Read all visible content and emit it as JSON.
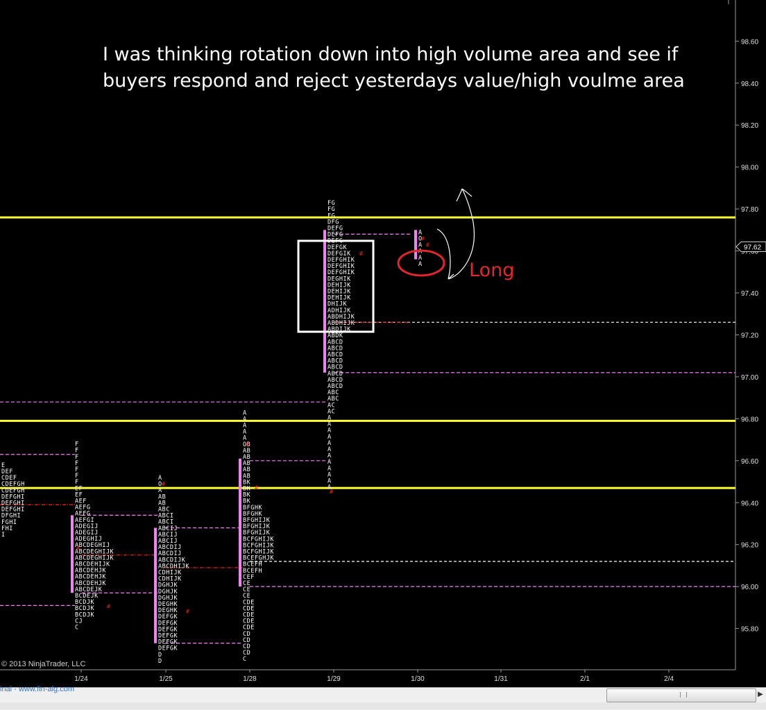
{
  "annotation": {
    "line1": "I was thinking rotation down into high volume area and see if",
    "line2": "buyers respond and reject yesterdays value/high voulme area",
    "long_label": "Long"
  },
  "copyright": "2013 NinjaTrader, LLC",
  "footer_link": "inal - www.fin-alg.com",
  "price_marker": "97.62",
  "colors": {
    "yellow": "#ffff33",
    "pink": "#ee82ee",
    "red": "#ff2020",
    "white": "#ffffff",
    "grid": "#555555"
  },
  "chart_data": {
    "type": "table",
    "description_free": true,
    "y_axis": {
      "ticks": [
        95.8,
        96.0,
        96.2,
        96.4,
        96.6,
        96.8,
        97.0,
        97.2,
        97.4,
        97.6,
        97.8,
        98.0,
        98.2,
        98.4,
        98.6
      ],
      "labels": [
        "95.80",
        "96.00",
        "96.20",
        "96.40",
        "96.60",
        "96.80",
        "97.00",
        "97.20",
        "97.40",
        "97.60",
        "97.80",
        "98.00",
        "98.20",
        "98.40",
        "98.60"
      ],
      "range": [
        95.64,
        98.72
      ]
    },
    "x_axis": {
      "categories": [
        "1/24",
        "1/25",
        "1/28",
        "1/29",
        "1/30",
        "1/31",
        "2/1",
        "2/4"
      ]
    },
    "horizontal_levels": [
      {
        "price": 97.76,
        "color": "yellow"
      },
      {
        "price": 96.79,
        "color": "yellow"
      },
      {
        "price": 96.47,
        "color": "yellow"
      }
    ],
    "reference_lines": [
      {
        "price": 97.68,
        "from": "1/29",
        "to": "1/30",
        "style": "pink-dash"
      },
      {
        "price": 97.26,
        "from": "1/29",
        "to": "end",
        "style": "white-dash"
      },
      {
        "price": 97.26,
        "from": "1/29",
        "to": "1/30",
        "style": "red-dashdot"
      },
      {
        "price": 97.02,
        "from": "1/29",
        "to": "end",
        "style": "pink-dash"
      },
      {
        "price": 96.88,
        "from": "start",
        "to": "1/29",
        "style": "pink-dash"
      },
      {
        "price": 96.63,
        "from": "start",
        "to": "1/24",
        "style": "pink-dash"
      },
      {
        "price": 96.6,
        "from": "1/28",
        "to": "1/29",
        "style": "pink-dash"
      },
      {
        "price": 96.12,
        "from": "1/28",
        "to": "end",
        "style": "white-dash"
      },
      {
        "price": 96.0,
        "from": "1/28",
        "to": "end",
        "style": "pink-dash"
      },
      {
        "price": 95.91,
        "from": "start",
        "to": "1/24",
        "style": "pink-dash"
      },
      {
        "price": 96.39,
        "from": "start",
        "to": "1/24",
        "style": "red-dashdot"
      },
      {
        "price": 96.34,
        "from": "1/24",
        "to": "1/25",
        "style": "pink-dash"
      },
      {
        "price": 96.15,
        "from": "1/24",
        "to": "1/25",
        "style": "red-dashdot"
      },
      {
        "price": 95.97,
        "from": "1/24",
        "to": "1/25",
        "style": "pink-dash"
      },
      {
        "price": 96.28,
        "from": "1/25",
        "to": "1/28",
        "style": "pink-dash"
      },
      {
        "price": 96.09,
        "from": "1/25",
        "to": "1/28",
        "style": "red-dashdot"
      },
      {
        "price": 95.73,
        "from": "1/25",
        "to": "1/28",
        "style": "pink-dash"
      }
    ],
    "profiles": [
      {
        "session": "1/23",
        "letters": [
          "E",
          "DEF",
          "CDEF",
          "CDEFGH",
          "CDEFGH",
          "DEFGHI",
          "DEFGHI",
          "DEFGHI",
          "DFGHI",
          "FGHI",
          "FHI",
          "I"
        ],
        "top": 96.57
      },
      {
        "session": "1/24",
        "letters": [
          "F",
          "F",
          "F",
          "F",
          "F",
          "F",
          "F",
          "EF",
          "EF",
          "AEF",
          "AEFG",
          "AEFG",
          "AEFGI",
          "ADEGIJ",
          "ADEGIJ",
          "ADEGHIJ",
          "ABCDEGHIJ",
          "ABCDEGHIJK",
          "ABCDEGHIJK",
          "ABCDEHIJK",
          "ABCDEHJK",
          "ABCDEHJK",
          "ABCDEHJK",
          "ABCDEJK",
          "BCDEJK",
          "BCDJK",
          "BCDJK",
          "BCDJK",
          "CJ",
          "C"
        ],
        "top": 96.67
      },
      {
        "session": "1/25",
        "letters": [
          "A",
          "O",
          "A",
          "AB",
          "AB",
          "ABC",
          "ABCI",
          "ABCI",
          "ABCIJ",
          "ABCIJ",
          "ABCIJ",
          "ABCDIJ",
          "ABCDIJ",
          "ABCDIJK",
          "ABCDHIJK",
          "CDHIJK",
          "CDHIJK",
          "DGHJK",
          "DGHJK",
          "DGHJK",
          "DEGHK",
          "DEGHK",
          "DEFGK",
          "DEFGK",
          "DEFGK",
          "DEFGK",
          "DEFGK",
          "DEFGK",
          "D",
          "D"
        ],
        "top": 96.51
      },
      {
        "session": "1/28",
        "letters": [
          "A",
          "A",
          "A",
          "A",
          "A",
          "OB",
          "AB",
          "AB",
          "AB",
          "AB",
          "AB",
          "BK",
          "BK",
          "BK",
          "BK",
          "BFGHK",
          "BFGHK",
          "BFGHIJK",
          "BFGHIJK",
          "BFGHIJK",
          "BCFGHIJK",
          "BCFGHIJK",
          "BCFGHIJK",
          "BCEFGHJK",
          "BCEFH",
          "BCEFH",
          "CEF",
          "CE",
          "CE",
          "CE",
          "CDE",
          "CDE",
          "CDE",
          "CDE",
          "CDE",
          "CD",
          "CD",
          "CD",
          "CD",
          "C"
        ],
        "top": 96.82
      },
      {
        "session": "1/29",
        "letters": [
          "FG",
          "FG",
          "FG",
          "DFG",
          "DEFG",
          "DEFG",
          "DEFG",
          "DEFGK",
          "DEFGIK",
          "DEFGHIK",
          "DEFGHIK",
          "DEFGHIK",
          "DEGHIK",
          "DEHIJK",
          "DEHIJK",
          "DEHIJK",
          "DHIJK",
          "ADHIJK",
          "ABDHIJK",
          "ABDHIJK",
          "ABDIJK",
          "ABDK",
          "ABCD",
          "ABCD",
          "ABCD",
          "ABCD",
          "ABCD",
          "ABCD",
          "ABCD",
          "ABCD",
          "ABC",
          "ABC",
          "AC",
          "AC",
          "A",
          "A",
          "A",
          "A",
          "A",
          "A",
          "A",
          "A",
          "A",
          "A",
          "A",
          "A"
        ],
        "top": 97.82
      },
      {
        "session": "1/30",
        "letters": [
          "A",
          "O",
          "A",
          "A",
          "A",
          "A"
        ],
        "top": 97.68
      }
    ]
  }
}
